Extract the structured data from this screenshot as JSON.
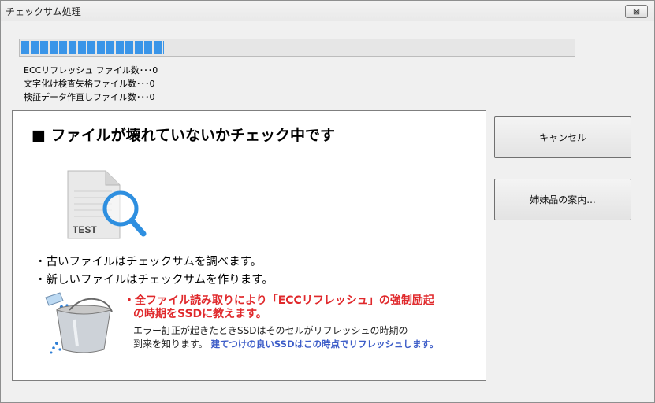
{
  "window": {
    "title": "チェックサム処理",
    "close_glyph": "⊠"
  },
  "progress": {
    "fraction": 0.259,
    "segments": 15
  },
  "stats": [
    "ECCリフレッシュ ファイル数･･･0",
    "文字化け検査失格ファイル数･･･0",
    "検証データ作直しファイル数･･･0"
  ],
  "panel": {
    "headline": "■ ファイルが壊れていないかチェック中です",
    "doc_label": "TEST",
    "bullets": [
      "・古いファイルはチェックサムを調べます。",
      "・新しいファイルはチェックサムを作ります。"
    ],
    "red_line1": "・全ファイル読み取りにより「ECCリフレッシュ」の強制励起",
    "red_line2": "の時期をSSDに教えます。",
    "desc_line1": "エラー訂正が起きたときSSDはそのセルがリフレッシュの時期の",
    "desc_line2_prefix": "到来を知ります。",
    "desc_line2_highlight": "建てつけの良いSSDはこの時点でリフレッシュします。"
  },
  "buttons": {
    "cancel": "キャンセル",
    "sister": "姉妹品の案内..."
  },
  "colors": {
    "progress": "#3a95e8",
    "red_text": "#e0292c",
    "blue_text": "#3d5dc8",
    "magnifier": "#2e8fe0"
  }
}
